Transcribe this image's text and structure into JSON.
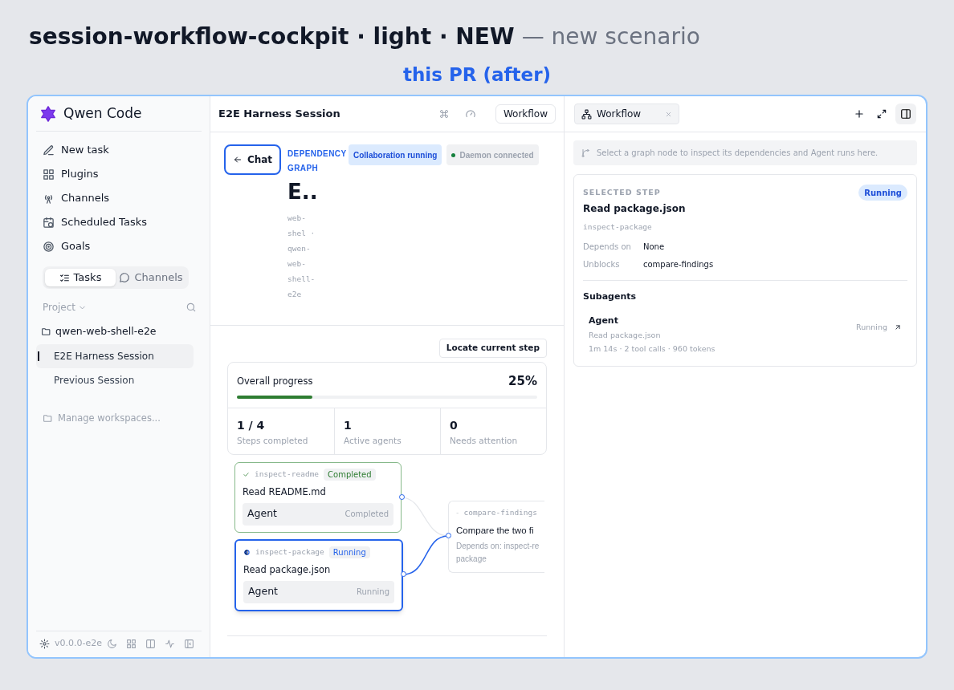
{
  "heading": "**session-workflow-cockpit · light · NEW** — new scenario",
  "subheading": "this PR (after)",
  "sidebar": {
    "brand": "Qwen Code",
    "nav": [
      {
        "label": "New task"
      },
      {
        "label": "Plugins"
      },
      {
        "label": "Channels"
      },
      {
        "label": "Scheduled Tasks"
      },
      {
        "label": "Goals"
      }
    ],
    "tabs": [
      {
        "label": "Tasks",
        "selected": true
      },
      {
        "label": "Channels",
        "selected": false
      }
    ],
    "project_label": "Project",
    "workspace": "qwen-web-shell-e2e",
    "sessions": [
      {
        "label": "E2E Harness Session",
        "selected": true
      },
      {
        "label": "Previous Session",
        "selected": false
      }
    ],
    "manage": "Manage workspaces...",
    "version": "v0.0.0-e2e"
  },
  "main": {
    "title": "E2E Harness Session",
    "workflow_button": "Workflow",
    "back_button": "Chat",
    "eyebrow": "DEPENDENCY GRAPH",
    "badges": [
      {
        "label": "Collaboration running",
        "kind": "accent"
      },
      {
        "label": "Daemon connected",
        "kind": "status",
        "color": "#15803d"
      }
    ],
    "page_title": "E..",
    "subtitle": "web-shel · qwen-web-shell-e2e",
    "locate_button": "Locate current step",
    "progress": {
      "label": "Overall progress",
      "value": "25%",
      "level": 0.25
    },
    "stats": [
      {
        "value": "1 / 4",
        "label": "Steps completed"
      },
      {
        "value": "1",
        "label": "Active agents"
      },
      {
        "value": "0",
        "label": "Needs attention"
      }
    ],
    "nodes": [
      {
        "id": "inspect-readme",
        "kind": "completed",
        "status": "Completed",
        "title": "Read README.md",
        "agent": "Agent",
        "agent_status": "Completed",
        "selected": false
      },
      {
        "id": "inspect-package",
        "kind": "running",
        "status": "Running",
        "title": "Read package.json",
        "agent": "Agent",
        "agent_status": "Running",
        "selected": true
      },
      {
        "id": "compare-findings",
        "kind": "pending",
        "title": "Compare the two fi",
        "depends": "Depends on: inspect-re package",
        "selected": false
      }
    ]
  },
  "panel": {
    "tab": "Workflow",
    "hint": "Select a graph node to inspect its dependencies and Agent runs here.",
    "eyebrow": "SELECTED STEP",
    "status": "Running",
    "title": "Read package.json",
    "step_id": "inspect-package",
    "rows": [
      {
        "key": "Depends on",
        "value": "None"
      },
      {
        "key": "Unblocks",
        "value": "compare-findings"
      }
    ],
    "subagents_title": "Subagents",
    "agent": {
      "name": "Agent",
      "task": "Read package.json",
      "status": "Running",
      "meta": "1m 14s · 2 tool calls · 960 tokens"
    }
  }
}
